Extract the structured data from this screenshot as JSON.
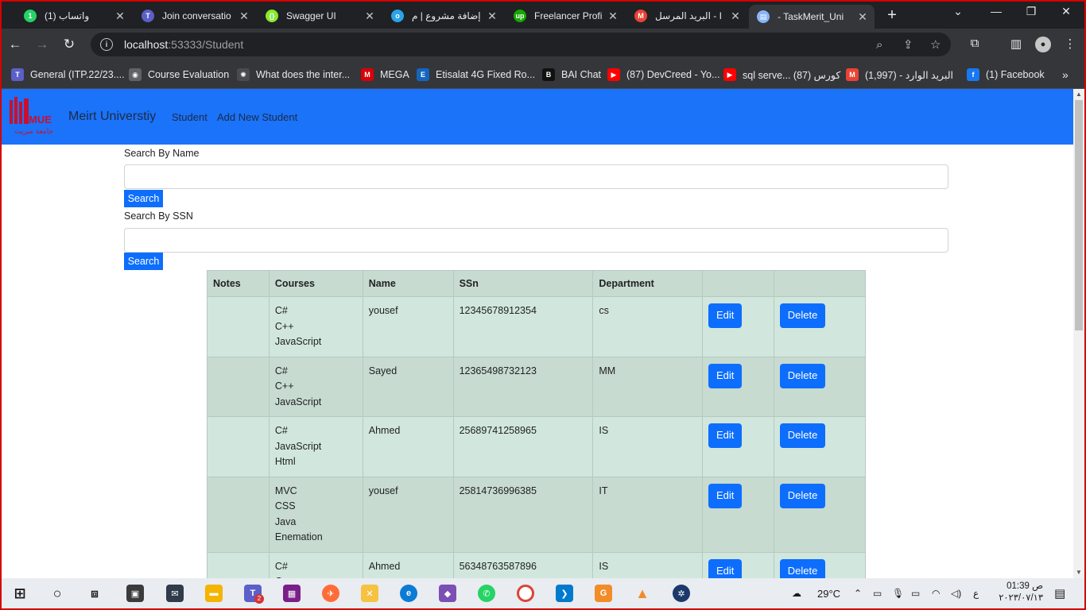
{
  "browser": {
    "tabs": [
      {
        "label": "(1) واتساب",
        "icon": "whatsapp-icon",
        "color": "#25d366",
        "glyph": "1"
      },
      {
        "label": "Join conversatio",
        "icon": "teams-icon",
        "color": "#5b5fc7",
        "glyph": "T"
      },
      {
        "label": "Swagger UI",
        "icon": "swagger-icon",
        "color": "#85ea2d",
        "glyph": "{}"
      },
      {
        "label": "إضافة مشروع | م",
        "icon": "mostaql-icon",
        "color": "#2aa4e8",
        "glyph": "o"
      },
      {
        "label": "Freelancer Profi",
        "icon": "upwork-icon",
        "color": "#14a800",
        "glyph": "up"
      },
      {
        "label": "البريد المرسل - I",
        "icon": "gmail-icon",
        "color": "#ea4335",
        "glyph": "M"
      },
      {
        "label": "- TaskMerit_Uni",
        "icon": "document-icon",
        "color": "#8ab4f8",
        "glyph": "▤"
      }
    ],
    "new_tab": "+",
    "url_host": "localhost",
    "url_path": ":53333/Student",
    "bookmarks": [
      {
        "label": "General (ITP.22/23....",
        "icon": "teams-icon",
        "color": "#5b5fc7",
        "glyph": "T"
      },
      {
        "label": "Course Evaluation",
        "icon": "globe-icon",
        "color": "#5f6368",
        "glyph": "◉"
      },
      {
        "label": "What does the inter...",
        "icon": "openai-icon",
        "color": "#4a4b4f",
        "glyph": "✺"
      },
      {
        "label": "MEGA",
        "icon": "mega-icon",
        "color": "#d90007",
        "glyph": "M"
      },
      {
        "label": "Etisalat 4G Fixed Ro...",
        "icon": "etisalat-icon",
        "color": "#1565c0",
        "glyph": "E"
      },
      {
        "label": "BAI Chat",
        "icon": "bai-icon",
        "color": "#111111",
        "glyph": "B"
      },
      {
        "label": "(87) DevCreed - Yo...",
        "icon": "youtube-icon",
        "color": "#ff0000",
        "glyph": "▶"
      },
      {
        "label": "sql serve... كورس (87)",
        "icon": "youtube-icon",
        "color": "#ff0000",
        "glyph": "▶"
      },
      {
        "label": "البريد الوارد - (1,997)",
        "icon": "gmail-icon",
        "color": "#ea4335",
        "glyph": "M"
      },
      {
        "label": "(1) Facebook",
        "icon": "facebook-icon",
        "color": "#1877f2",
        "glyph": "f"
      }
    ]
  },
  "site": {
    "brand": "Meirt Universtiy",
    "logo_text": "MUE",
    "logo_subtext": "جامعة ميريت",
    "nav": [
      "Student",
      "Add New Student"
    ],
    "colors": {
      "navbar": "#1a73f8",
      "button": "#0d6efd",
      "row_light": "#d1e7dd",
      "row_dark": "#c7dbd1"
    }
  },
  "search": {
    "name_label": "Search By Name",
    "name_value": "",
    "ssn_label": "Search By SSN",
    "ssn_value": "",
    "button_label": "Search"
  },
  "table": {
    "headers": [
      "Notes",
      "Courses",
      "Name",
      "SSn",
      "Department",
      "",
      ""
    ],
    "edit_label": "Edit",
    "delete_label": "Delete",
    "rows": [
      {
        "notes": "",
        "courses": [
          "C#",
          "C++",
          "JavaScript"
        ],
        "name": "yousef",
        "ssn": "12345678912354",
        "department": "cs"
      },
      {
        "notes": "",
        "courses": [
          "C#",
          "C++",
          "JavaScript"
        ],
        "name": "Sayed",
        "ssn": "12365498732123",
        "department": "MM"
      },
      {
        "notes": "",
        "courses": [
          "C#",
          "JavaScript",
          "Html"
        ],
        "name": "Ahmed",
        "ssn": "25689741258965",
        "department": "IS"
      },
      {
        "notes": "",
        "courses": [
          "MVC",
          "CSS",
          "Java",
          "Enemation"
        ],
        "name": "yousef",
        "ssn": "25814736996385",
        "department": "IT"
      },
      {
        "notes": "",
        "courses": [
          "C#",
          "C++"
        ],
        "name": "Ahmed",
        "ssn": "56348763587896",
        "department": "IS"
      }
    ]
  },
  "taskbar": {
    "weather": "29°C",
    "lang": "ع",
    "time": "ص 01:39",
    "date": "٢٠٢٣/٠٧/١٣",
    "notification_badge": "2"
  }
}
